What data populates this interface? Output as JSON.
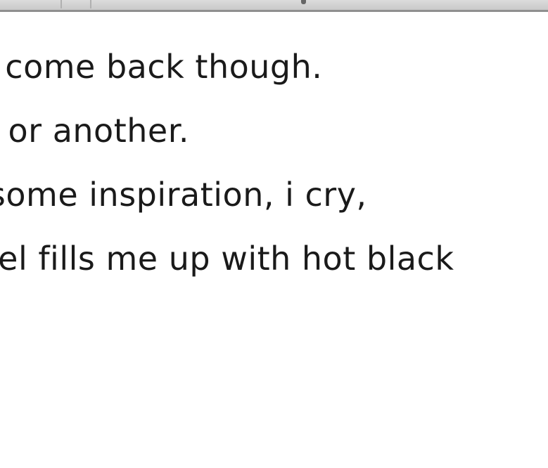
{
  "content": {
    "lines": [
      "vs come back though.",
      "ay or another.",
      "e some inspiration, i cry,",
      "sriel fills me up with hot black"
    ],
    "link_fragment": "!"
  },
  "colors": {
    "text": "#1a1a1a",
    "link": "#2a6fb3",
    "toolbar": "#c9c9c9"
  }
}
